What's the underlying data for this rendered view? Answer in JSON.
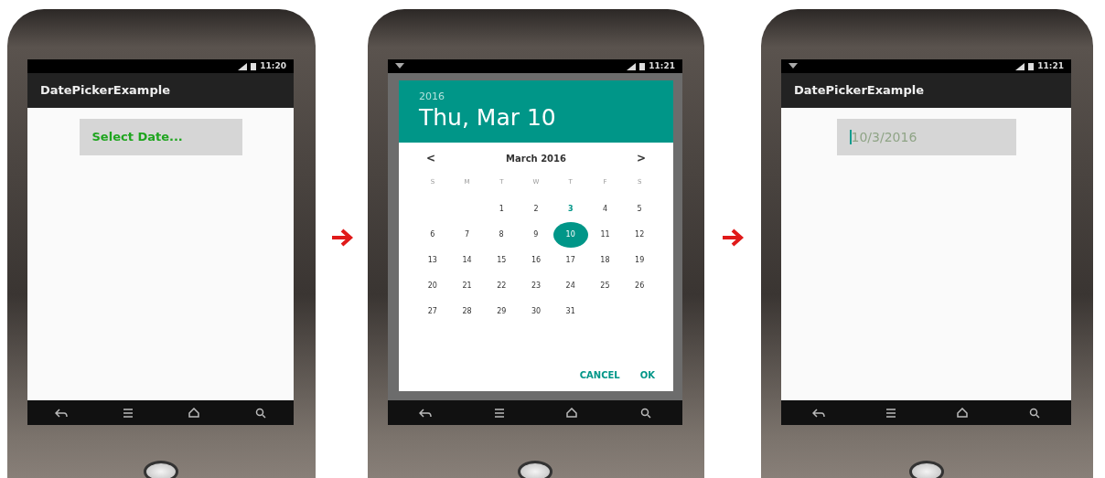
{
  "screens": [
    {
      "kind": "form",
      "status": {
        "time": "11:20",
        "notification_icon": false
      },
      "title": "DatePickerExample",
      "date_field": {
        "value": "Select Date...",
        "focused": false
      }
    },
    {
      "kind": "picker",
      "status": {
        "time": "11:21",
        "notification_icon": true
      },
      "dialog": {
        "year": "2016",
        "date": "Thu, Mar 10",
        "month": "March 2016",
        "prev": "<",
        "next": ">",
        "weekdays": [
          "S",
          "M",
          "T",
          "W",
          "T",
          "F",
          "S"
        ],
        "weeks": [
          [
            {
              "label": "1",
              "today": false,
              "selected": false
            },
            {
              "label": "2",
              "today": false,
              "selected": false
            },
            {
              "label": "3",
              "today": true,
              "selected": false
            },
            {
              "label": "4",
              "today": false,
              "selected": false
            },
            {
              "label": "5",
              "today": false,
              "selected": false
            }
          ],
          [
            {
              "label": "6",
              "today": false,
              "selected": false
            },
            {
              "label": "7",
              "today": false,
              "selected": false
            },
            {
              "label": "8",
              "today": false,
              "selected": false
            },
            {
              "label": "9",
              "today": false,
              "selected": false
            },
            {
              "label": "10",
              "today": false,
              "selected": true
            },
            {
              "label": "11",
              "today": false,
              "selected": false
            },
            {
              "label": "12",
              "today": false,
              "selected": false
            }
          ],
          [
            {
              "label": "13",
              "today": false,
              "selected": false
            },
            {
              "label": "14",
              "today": false,
              "selected": false
            },
            {
              "label": "15",
              "today": false,
              "selected": false
            },
            {
              "label": "16",
              "today": false,
              "selected": false
            },
            {
              "label": "17",
              "today": false,
              "selected": false
            },
            {
              "label": "18",
              "today": false,
              "selected": false
            },
            {
              "label": "19",
              "today": false,
              "selected": false
            }
          ],
          [
            {
              "label": "20",
              "today": false,
              "selected": false
            },
            {
              "label": "21",
              "today": false,
              "selected": false
            },
            {
              "label": "22",
              "today": false,
              "selected": false
            },
            {
              "label": "23",
              "today": false,
              "selected": false
            },
            {
              "label": "24",
              "today": false,
              "selected": false
            },
            {
              "label": "25",
              "today": false,
              "selected": false
            },
            {
              "label": "26",
              "today": false,
              "selected": false
            }
          ],
          [
            {
              "label": "27",
              "today": false,
              "selected": false
            },
            {
              "label": "28",
              "today": false,
              "selected": false
            },
            {
              "label": "29",
              "today": false,
              "selected": false
            },
            {
              "label": "30",
              "today": false,
              "selected": false
            },
            {
              "label": "31",
              "today": false,
              "selected": false
            }
          ]
        ],
        "buttons": [
          "CANCEL",
          "OK"
        ]
      }
    },
    {
      "kind": "form",
      "status": {
        "time": "11:21",
        "notification_icon": true
      },
      "title": "DatePickerExample",
      "date_field": {
        "value": "10/3/2016",
        "focused": true
      }
    }
  ]
}
